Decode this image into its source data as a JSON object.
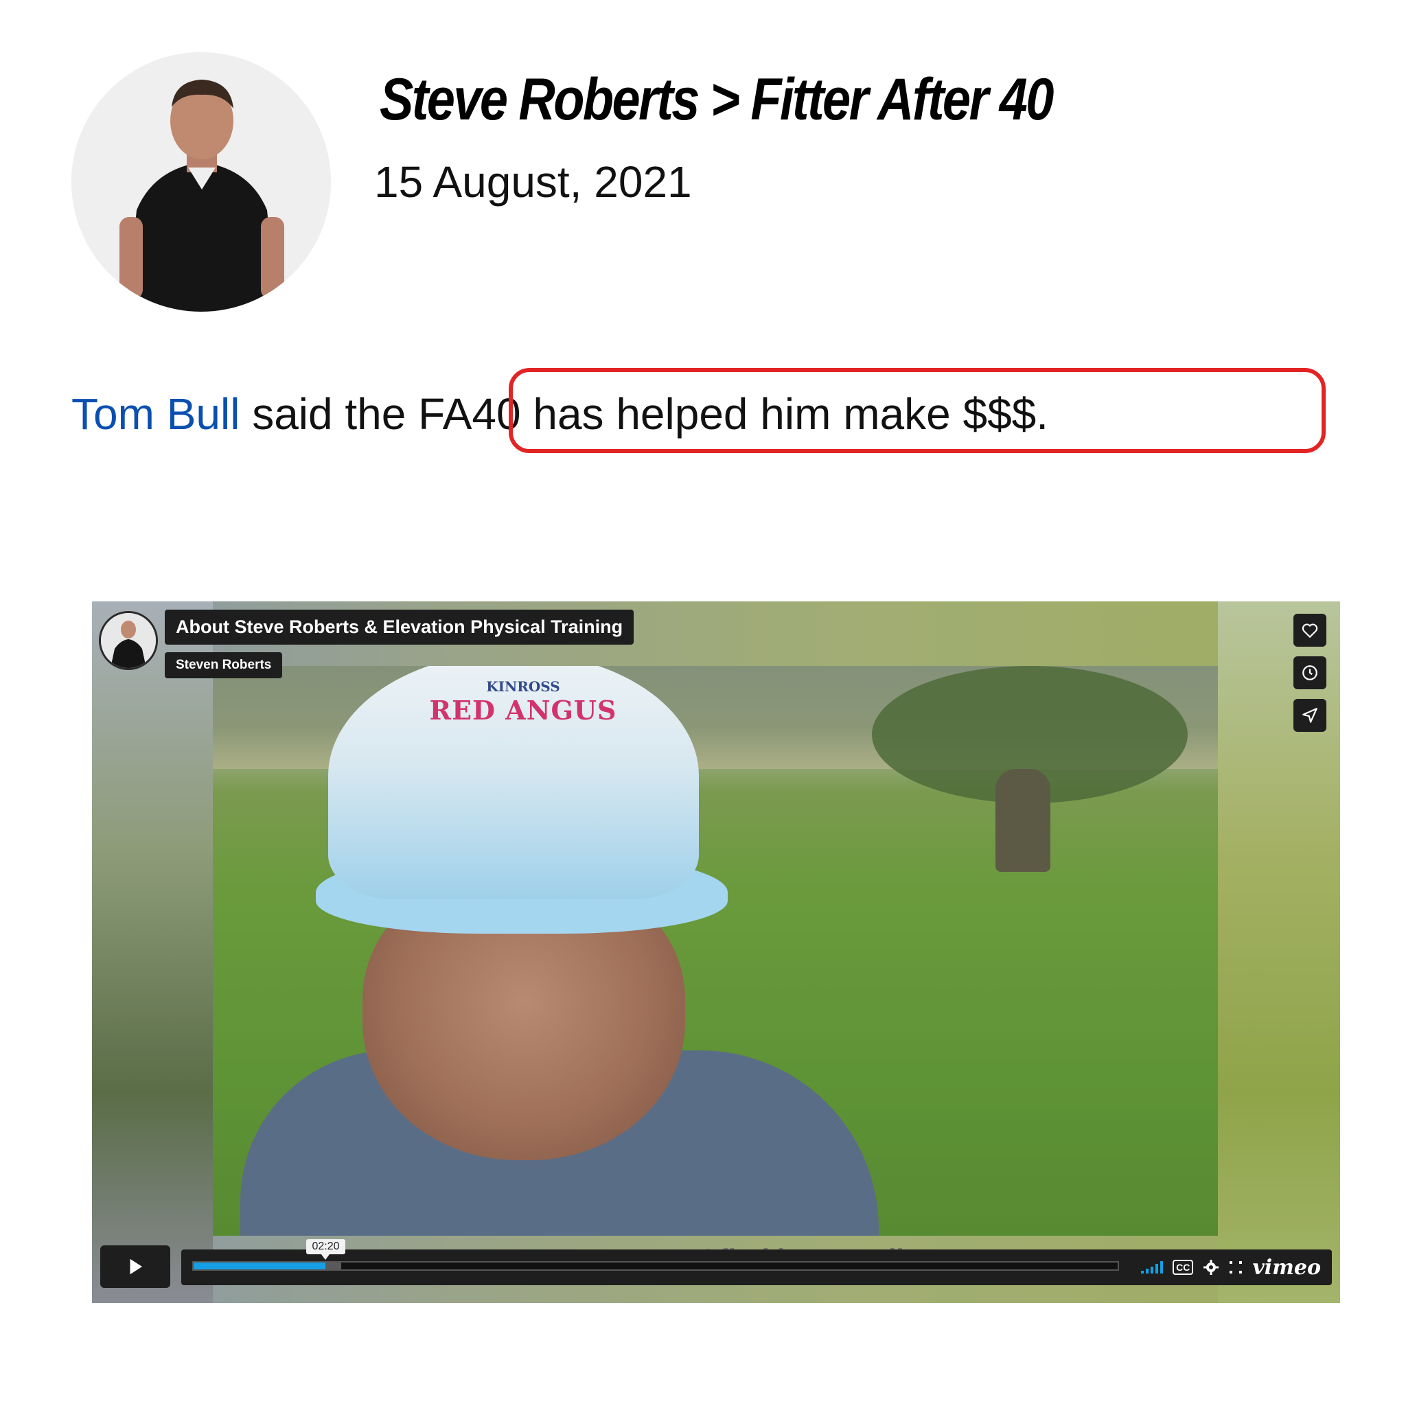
{
  "header": {
    "title": "Steve Roberts > Fitter After 40",
    "date": "15 August, 2021"
  },
  "testimonial": {
    "name": "Tom Bull",
    "text_before": "said the",
    "highlighted_text": "FA40 has helped him make $$$."
  },
  "video": {
    "title": "About Steve Roberts & Elevation Physical Training",
    "byline": "Steven Roberts",
    "cap_text_top": "KINROSS",
    "cap_text_main": "RED ANGUS",
    "subtitle": "I find is mentally",
    "current_time": "02:20",
    "progress_fraction": 0.143,
    "buffered_fraction": 0.16,
    "brand": "vimeo",
    "side_icons": [
      "heart-icon",
      "clock-icon",
      "send-icon"
    ],
    "accent_color": "#15a0e6"
  },
  "colors": {
    "name_link": "#0b4fb0",
    "highlight_border": "#e32424"
  }
}
